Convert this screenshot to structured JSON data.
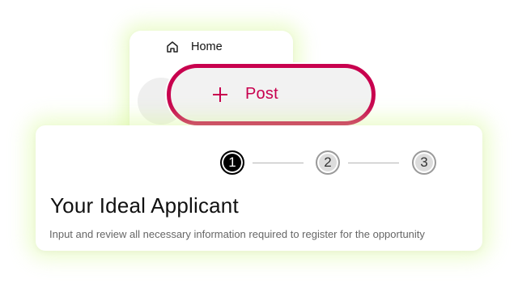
{
  "nav": {
    "home_label": "Home",
    "home_icon": "home-icon"
  },
  "post_button": {
    "label": "Post",
    "icon": "plus-icon",
    "accent_color": "#c8004e"
  },
  "stepper": {
    "steps": [
      {
        "label": "1",
        "state": "active"
      },
      {
        "label": "2",
        "state": "inactive"
      },
      {
        "label": "3",
        "state": "inactive"
      }
    ]
  },
  "main": {
    "title": "Your Ideal Applicant",
    "subtitle": "Input and review all necessary information required to register for the opportunity"
  }
}
